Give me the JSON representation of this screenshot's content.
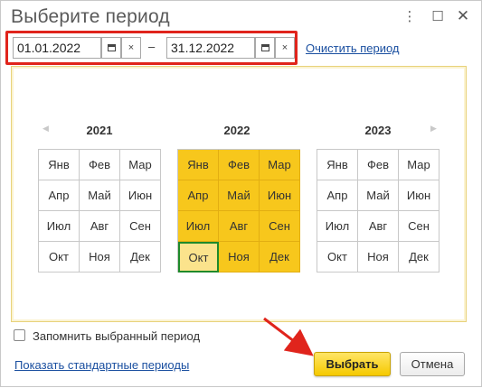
{
  "window": {
    "title": "Выберите период",
    "more_glyph": "⋮",
    "maximize_glyph": "☐",
    "close_glyph": "✕"
  },
  "period": {
    "from_value": "01.01.2022",
    "to_value": "31.12.2022",
    "separator": "–",
    "clear_glyph": "×",
    "clear_link": "Очистить период"
  },
  "calendar": {
    "prev_glyph": "◀",
    "next_glyph": "▶",
    "years": [
      {
        "label": "2021",
        "months": [
          "Янв",
          "Фев",
          "Мар",
          "Апр",
          "Май",
          "Июн",
          "Июл",
          "Авг",
          "Сен",
          "Окт",
          "Ноя",
          "Дек"
        ],
        "selected": false
      },
      {
        "label": "2022",
        "months": [
          "Янв",
          "Фев",
          "Мар",
          "Апр",
          "Май",
          "Июн",
          "Июл",
          "Авг",
          "Сен",
          "Окт",
          "Ноя",
          "Дек"
        ],
        "selected": true,
        "current_month": "Окт"
      },
      {
        "label": "2023",
        "months": [
          "Янв",
          "Фев",
          "Мар",
          "Апр",
          "Май",
          "Июн",
          "Июл",
          "Авг",
          "Сен",
          "Окт",
          "Ноя",
          "Дек"
        ],
        "selected": false
      }
    ]
  },
  "remember_checkbox": {
    "label": "Запомнить выбранный период",
    "checked": false
  },
  "standard_periods_link": "Показать стандартные периоды",
  "buttons": {
    "select": "Выбрать",
    "cancel": "Отмена"
  },
  "colors": {
    "selected_month": "#f7c71c",
    "current_month_border": "#1f8a2a",
    "highlight_frame": "#e0241c",
    "link": "#1a4fa0",
    "primary_button": "#f5c900"
  }
}
